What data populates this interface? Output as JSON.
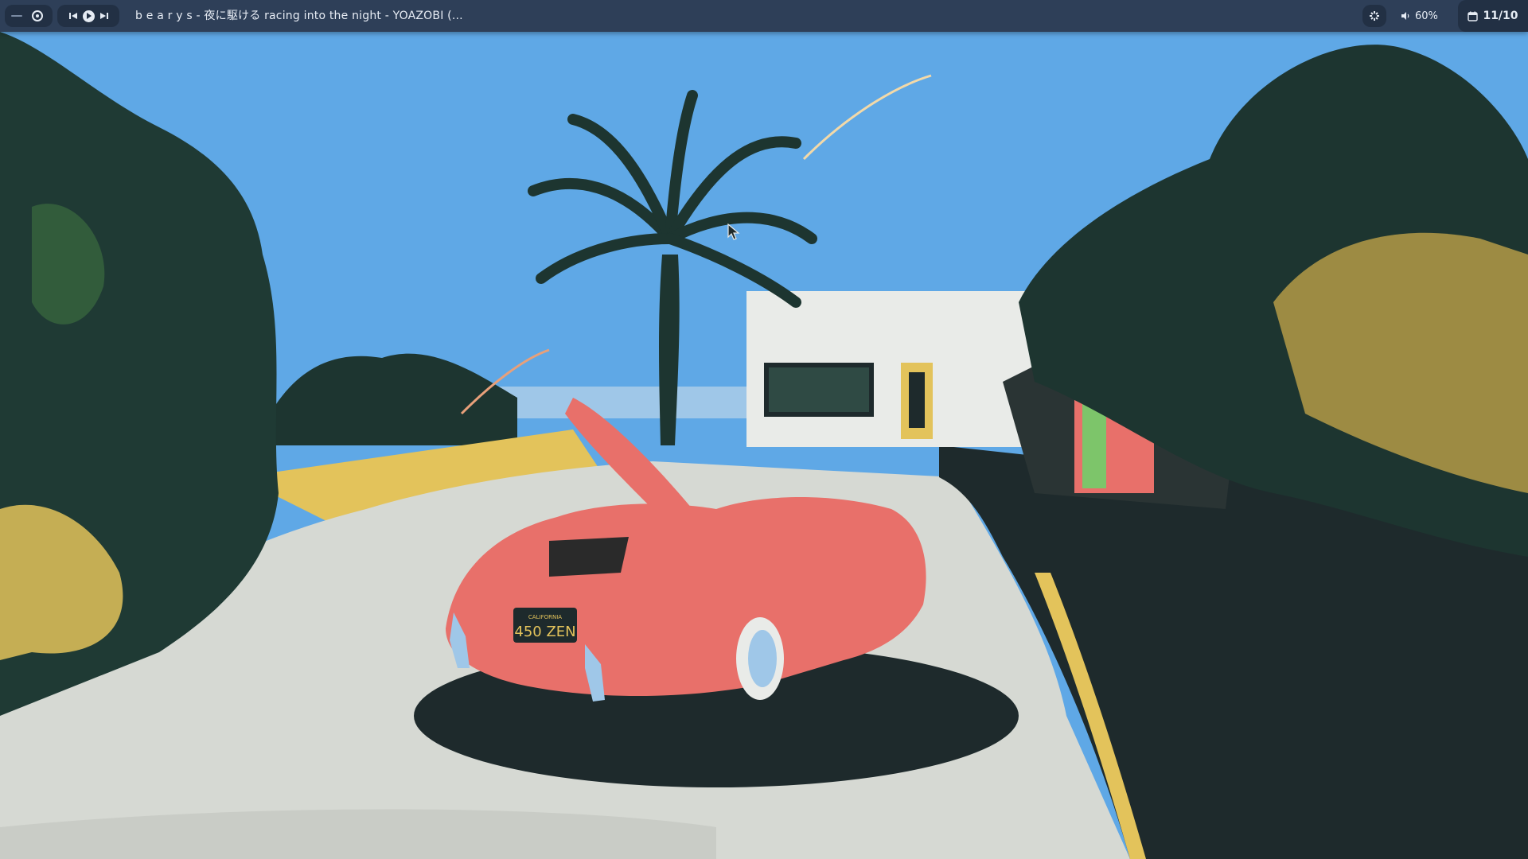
{
  "topbar": {
    "now_playing": "b e a r y s - 夜に駆ける racing into the night - YOAZOBI (...",
    "volume_level": "60%",
    "date": "11/10",
    "icons": {
      "workspace_indicator": "dash-icon",
      "record": "record-icon",
      "previous": "skip-previous-icon",
      "play": "play-circle-icon",
      "next": "skip-next-icon",
      "tray": "tray-app-icon",
      "volume": "speaker-icon",
      "calendar": "calendar-icon"
    }
  },
  "wallpaper": {
    "license_plate_state": "CALIFORNIA",
    "license_plate": "450 ZEN",
    "description_colors": {
      "sky": "#5fa8e6",
      "car": "#e8706a",
      "foliage": "#1f3a34",
      "road": "#d9dcd8",
      "accent_yellow": "#e8c75a"
    }
  }
}
